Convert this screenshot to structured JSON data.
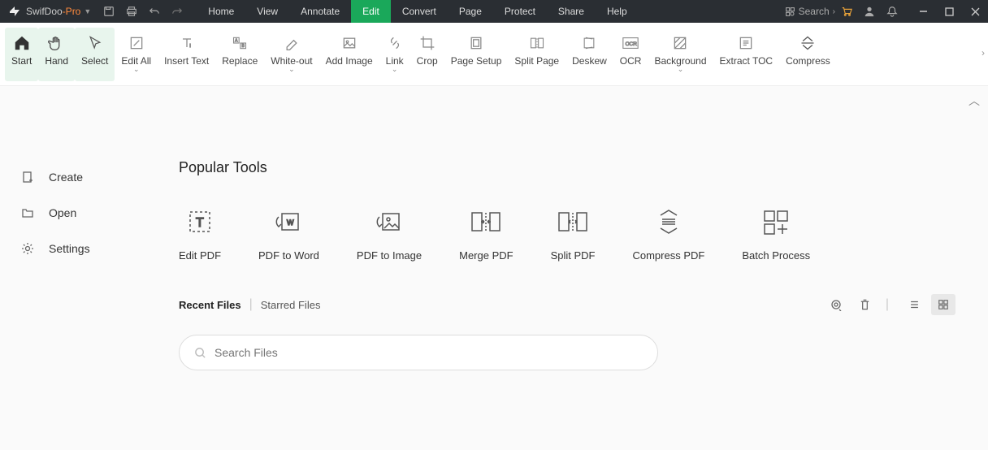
{
  "title": {
    "app": "SwifDoo",
    "suffix": "-Pro"
  },
  "menu": [
    "Home",
    "View",
    "Annotate",
    "Edit",
    "Convert",
    "Page",
    "Protect",
    "Share",
    "Help"
  ],
  "menu_active": 3,
  "search_label": "Search",
  "ribbon": [
    {
      "label": "Start",
      "sel": true
    },
    {
      "label": "Hand",
      "sel": true
    },
    {
      "label": "Select",
      "sel": true
    },
    {
      "label": "Edit All"
    },
    {
      "label": "Insert Text"
    },
    {
      "label": "Replace"
    },
    {
      "label": "White-out"
    },
    {
      "label": "Add Image"
    },
    {
      "label": "Link"
    },
    {
      "label": "Crop"
    },
    {
      "label": "Page Setup"
    },
    {
      "label": "Split Page"
    },
    {
      "label": "Deskew"
    },
    {
      "label": "OCR"
    },
    {
      "label": "Background"
    },
    {
      "label": "Extract TOC"
    },
    {
      "label": "Compress"
    }
  ],
  "sidebar": [
    {
      "label": "Create"
    },
    {
      "label": "Open"
    },
    {
      "label": "Settings"
    }
  ],
  "popular_title": "Popular Tools",
  "popular": [
    {
      "label": "Edit PDF"
    },
    {
      "label": "PDF to Word"
    },
    {
      "label": "PDF to Image"
    },
    {
      "label": "Merge PDF"
    },
    {
      "label": "Split PDF"
    },
    {
      "label": "Compress PDF"
    },
    {
      "label": "Batch Process"
    }
  ],
  "files_tabs": [
    "Recent Files",
    "Starred Files"
  ],
  "files_tab_active": 0,
  "search_placeholder": "Search Files"
}
